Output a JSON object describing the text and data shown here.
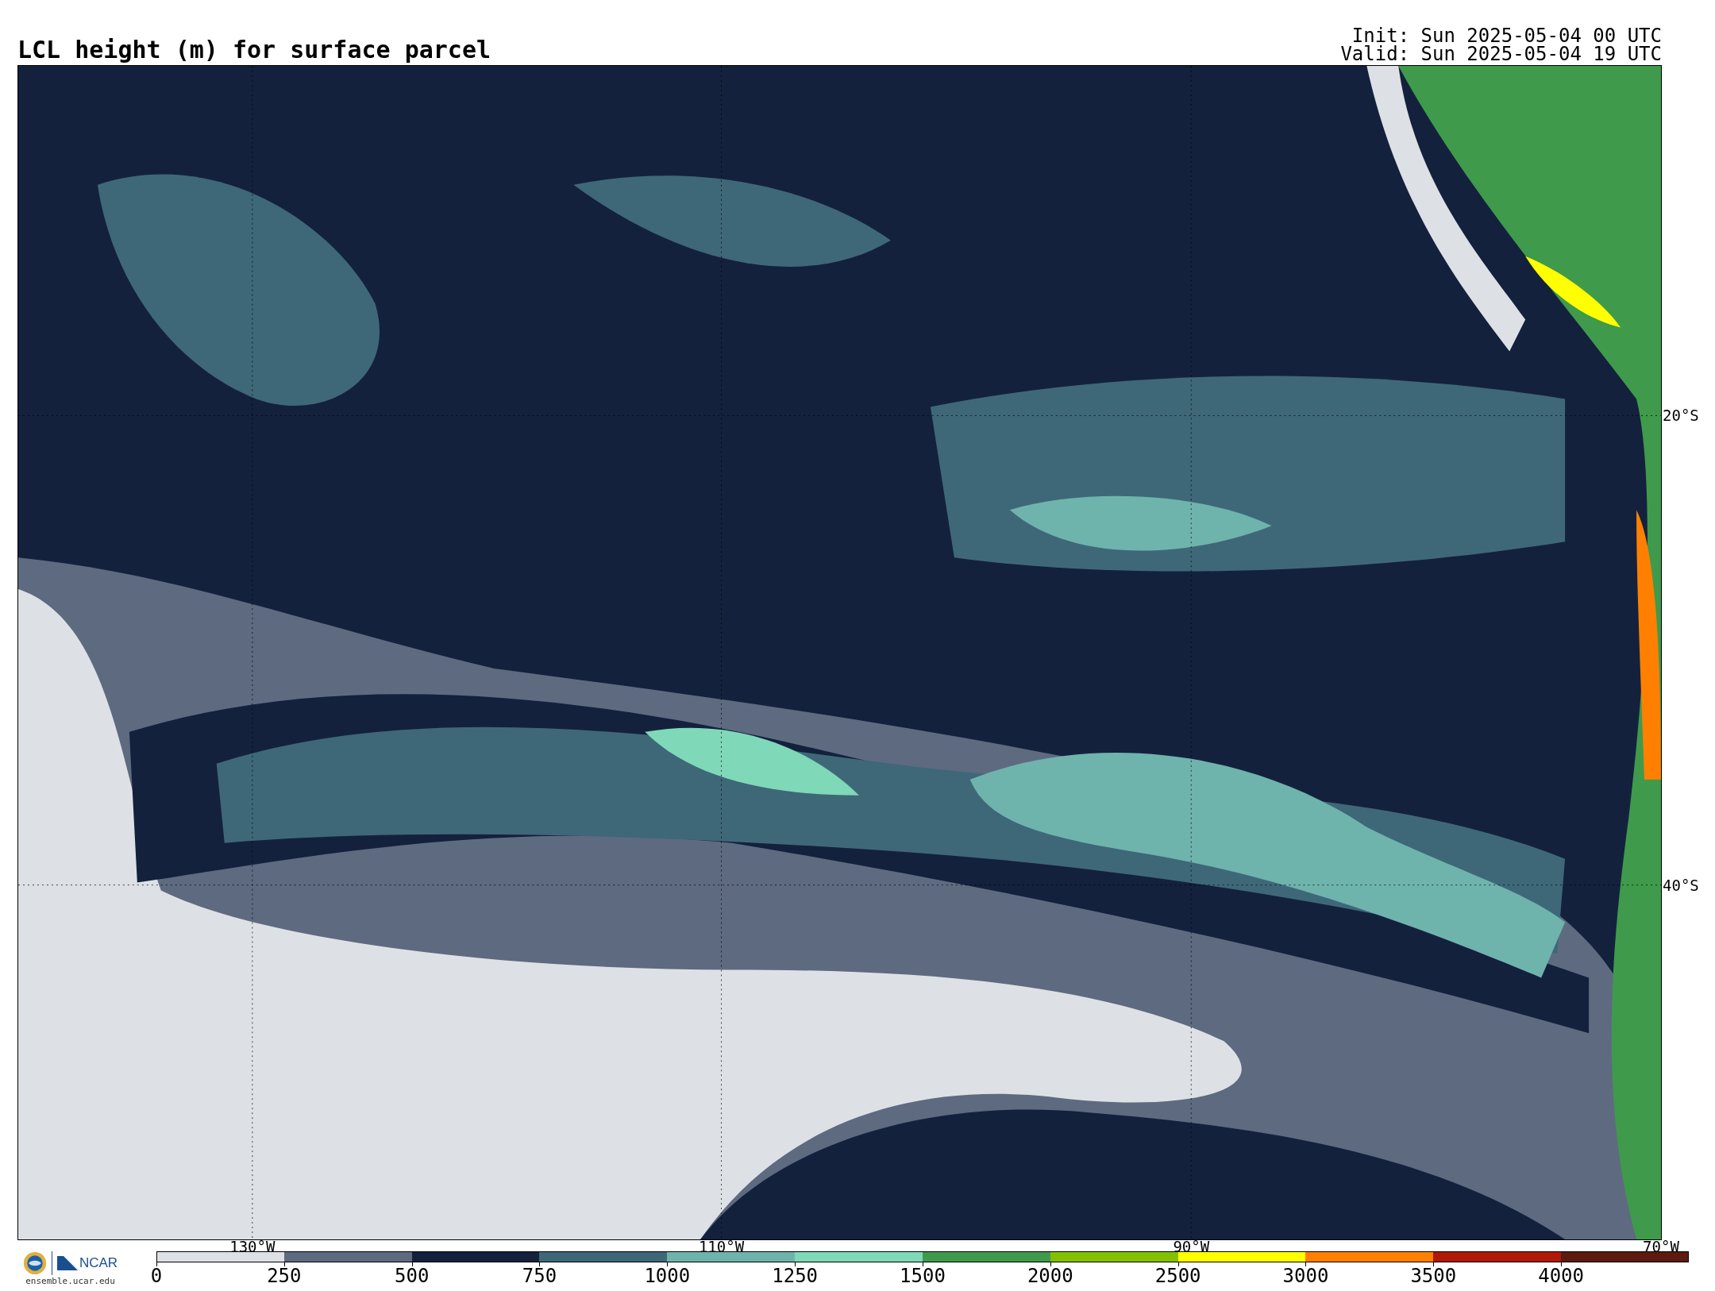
{
  "title": "LCL height (m) for surface parcel",
  "init": "Init: Sun 2025-05-04 00 UTC",
  "valid": "Valid: Sun 2025-05-04 19 UTC",
  "map": {
    "latitude_labels": [
      "20°S",
      "40°S"
    ],
    "longitude_labels": [
      "130°W",
      "110°W",
      "90°W",
      "70°W"
    ]
  },
  "colorbar": {
    "segments": [
      {
        "label": "0",
        "color": "#dde1e5"
      },
      {
        "label": "250",
        "color": "#5e6a80"
      },
      {
        "label": "500",
        "color": "#14213d"
      },
      {
        "label": "750",
        "color": "#3e6878"
      },
      {
        "label": "1000",
        "color": "#6fb3ad"
      },
      {
        "label": "1250",
        "color": "#7fd8b8"
      },
      {
        "label": "1500",
        "color": "#3f9a4c"
      },
      {
        "label": "2000",
        "color": "#84c000"
      },
      {
        "label": "2500",
        "color": "#ffff00"
      },
      {
        "label": "3000",
        "color": "#ff8000"
      },
      {
        "label": "3500",
        "color": "#b01808"
      },
      {
        "label": "4000",
        "color": "#5c1a10"
      }
    ]
  },
  "footer": {
    "logo_text": "NCAR",
    "url": "ensemble.ucar.edu"
  }
}
